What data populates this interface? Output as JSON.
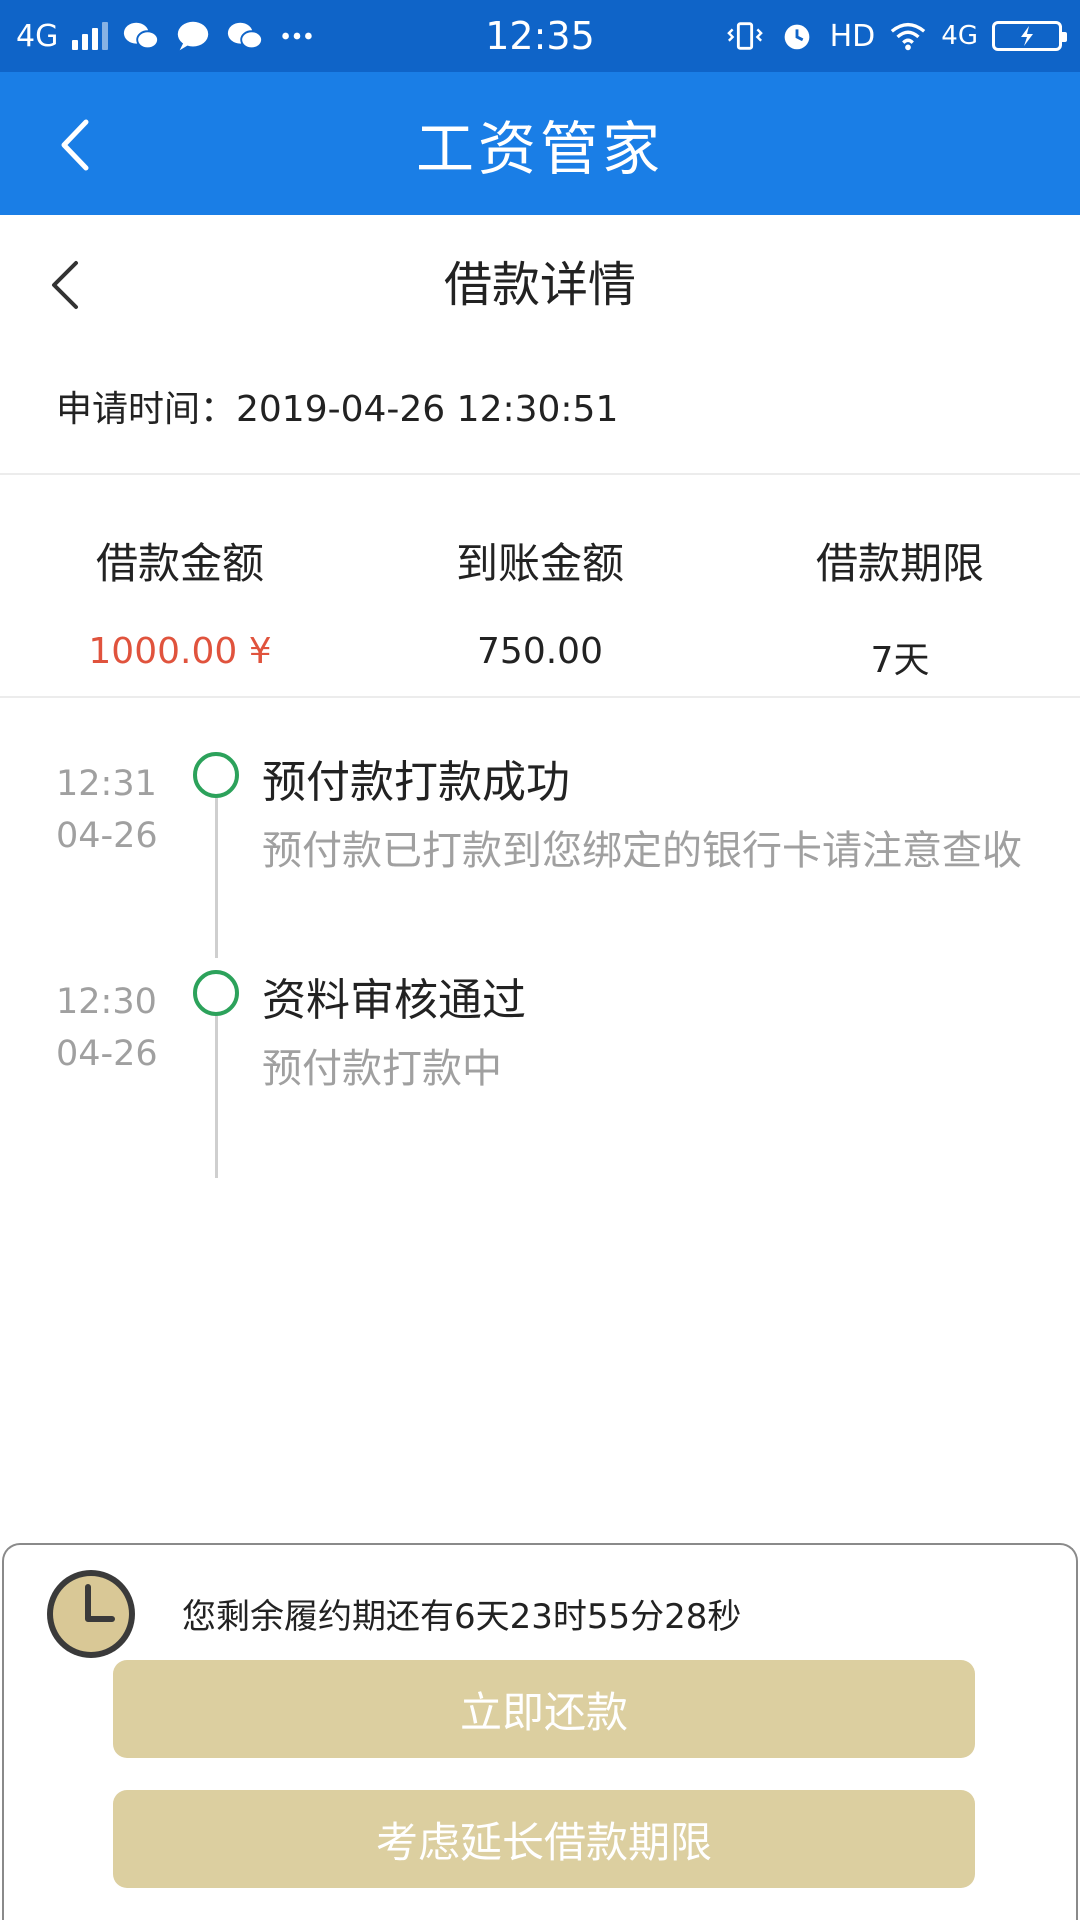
{
  "status_bar": {
    "network": "4G",
    "time": "12:35",
    "hd": "HD",
    "network_right": "4G"
  },
  "app_bar": {
    "title": "工资管家"
  },
  "page": {
    "title": "借款详情"
  },
  "apply_time": "申请时间：2019-04-26 12:30:51",
  "summary": [
    {
      "label": "借款金额",
      "value": "1000.00 ¥",
      "highlight": "#e0533d"
    },
    {
      "label": "到账金额",
      "value": "750.00"
    },
    {
      "label": "借款期限",
      "value": "7天"
    }
  ],
  "timeline": [
    {
      "time": "12:31",
      "date": "04-26",
      "title": "预付款打款成功",
      "desc": "预付款已打款到您绑定的银行卡请注意查收"
    },
    {
      "time": "12:30",
      "date": "04-26",
      "title": "资料审核通过",
      "desc": "预付款打款中"
    }
  ],
  "bottom": {
    "countdown": "您剩余履约期还有6天23时55分28秒",
    "repay_button": "立即还款",
    "extend_button": "考虑延长借款期限"
  },
  "colors": {
    "status_bar": "#0f64c8",
    "app_bar": "#1a7ee6",
    "success_dot": "#2ca25b",
    "button": "#dccfa0",
    "amount_red": "#e0533d"
  }
}
